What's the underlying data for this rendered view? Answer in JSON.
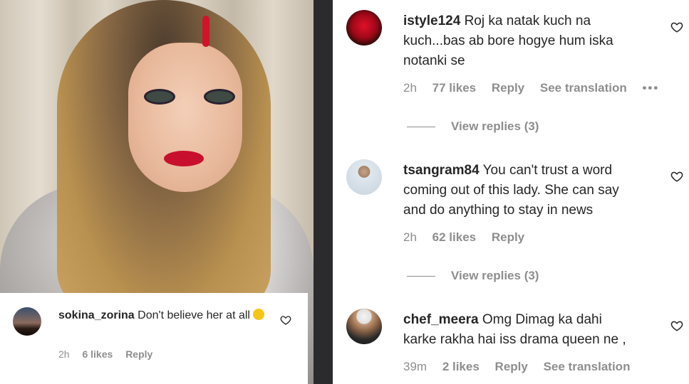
{
  "icons": {
    "heart": "heart-outline-icon",
    "more": "more-horizontal-icon",
    "emoji": "laughing-crying-emoji"
  },
  "photo_comment": {
    "username": "sokina_zorina",
    "text": "Don't believe her at all",
    "time": "2h",
    "likes": "6 likes",
    "reply": "Reply"
  },
  "comments": [
    {
      "username": "istyle124",
      "text_line1": "Roj ka natak kuch na",
      "text_line2": "kuch...bas ab bore hogye hum iska",
      "text_line3": "notanki se",
      "time": "2h",
      "likes": "77 likes",
      "reply": "Reply",
      "see_translation": "See translation",
      "more": "•••",
      "view_replies": "View replies (3)"
    },
    {
      "username": "tsangram84",
      "text_line1": "You can't trust a word",
      "text_line2": "coming out of this lady. She can say",
      "text_line3": "and do anything to stay in news",
      "time": "2h",
      "likes": "62 likes",
      "reply": "Reply",
      "view_replies": "View replies (3)"
    },
    {
      "username": "chef_meera",
      "text_line1": "Omg Dimag ka dahi",
      "text_line2": "karke rakha hai iss drama queen ne ,",
      "time": "39m",
      "likes": "2 likes",
      "reply": "Reply",
      "see_translation": "See translation"
    }
  ]
}
